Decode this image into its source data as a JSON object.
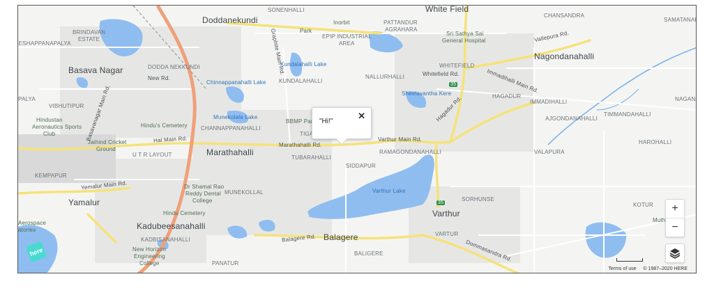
{
  "popup": {
    "text": "\"Hi!\"",
    "close_glyph": "✕"
  },
  "controls": {
    "zoom_in": "+",
    "zoom_out": "−",
    "layers_icon": "layers-icon"
  },
  "footer": {
    "terms": "Terms of use",
    "copyright": "© 1987–2020 HERE"
  },
  "logo": {
    "text": "here"
  },
  "colors": {
    "water": "#8fbdf0",
    "highway": "#f0a07a",
    "main_road": "#f5e27a",
    "land": "#f4f5f3",
    "urban": "#e3e4e2"
  },
  "labels": {
    "towns": {
      "doddanekundi": "Doddanekundi",
      "whitefield": "White Field",
      "basava_nagar": "Basava Nagar",
      "nagondanahalli": "Nagondanahalli",
      "marathahalli": "Marathahalli",
      "yamalur": "Yamalur",
      "kadubeesanahalli": "Kadubeesanahalli",
      "balagere": "Balagere",
      "varthur": "Varthur"
    },
    "areas": {
      "sonenhalli": "SONENHALLI",
      "chansandra": "CHANSANDRA",
      "samatanahalli": "SAMATANAHAL",
      "brindavan": "BRINDAVAN",
      "estate": "ESTATE",
      "leshappa": "LESHAPPANAPALYA",
      "pattandur": "PATTANDUR",
      "agrahara": "AGRAHARA",
      "epip": "EPIP INDUSTRIAL",
      "area": "AREA",
      "dodda_nekkundi": "DODDA NEKKUNDI",
      "nallurhalli": "NALLURHALLI",
      "whitefield_caps": "WHITEFIELD",
      "kundalahalli": "KUNDALAHALLI",
      "hagadur": "HAGADUR",
      "immadihalli": "IMMADIHALLI",
      "nagana": "NAGANA",
      "palya": "PALYA",
      "vibhutipur": "VIBHUTIPUR",
      "channappanahalli": "CHANNAPPANAHALLI",
      "tiga": "TIGA",
      "timmandahalli": "TIMMANDAHALLI",
      "ajgondanahalli": "AJGONDANAHALLI",
      "harohalli": "HAROHALLI",
      "utr_layout": "U T R LAYOUT",
      "tubarahalli": "TUBARAHALLI",
      "ramagondanahalli": "RAMAGONDANAHALLI",
      "valapura": "VALAPURA",
      "siddapur": "SIDDAPUR",
      "kempapur": "KEMPAPUR",
      "munekollal": "MUNEKOLLAL",
      "sorhunse": "SORHUNSE",
      "kotur": "KOTUR",
      "kadbisanahalli": "KADBISANAHALLI",
      "varthur_caps": "VARTUR",
      "baligere": "BALIGERE",
      "panatur": "PANATUR"
    },
    "water": {
      "kundalahalli_lake": "Kundalahalli Lake",
      "chinnappanahalli_lake": "Chinnappanahalli Lake",
      "munekolala_lake": "Munekolala Lake",
      "sheelavantha_kere": "Sheelavantha Kere",
      "varthur_lake": "Varthur Lake"
    },
    "roads": {
      "graphite_main": "Graphite Main Rd.",
      "new_rd": "New Rd.",
      "whitefield_rd": "Whitefield Rd.",
      "immadihalli_rd": "Immadihalli Main Rd.",
      "vallepura_rd": "Vallepura Rd.",
      "basavanagar_main": "Basavanagar Main Rd.",
      "hal_main": "Hal Main Rd.",
      "marathahalli_rd": "Marathahalli Rd.",
      "varthur_main": "Varthur Main Rd.",
      "hagadur_rd": "Hagadur Rd.",
      "yemalur_main": "Yemalur Main Rd.",
      "balagere_rd": "Balagere Rd.",
      "dommasandra_rd": "Dommasandra Rd."
    },
    "poi": {
      "inorbit": "Inorbit",
      "park": "Park",
      "sathya_sai": "Sri Sathya Sai",
      "general_hospital": "General Hospital",
      "hindus_cemetery": "Hindu's Cemetery",
      "hindustan": "Hindustan",
      "aeronautics": "Aeronautics Sports",
      "club": "Club",
      "jaihind": "Jaihind Cricket",
      "ground": "Ground",
      "bbmp_park": "BBMP Park",
      "hindu_cemetery2": "Hindu Cemetery",
      "shamrao": "Dr Shamal Rao",
      "reddy": "Reddy Dental",
      "college": "College",
      "new_horizon": "New Horizon",
      "engineering": "Engineering",
      "college2": "College",
      "aerospace": "Aerospace",
      "labs": "atories",
      "muthsa": "Muths"
    },
    "shields": {
      "s35_top": "35",
      "s35_bottom": "35"
    }
  }
}
